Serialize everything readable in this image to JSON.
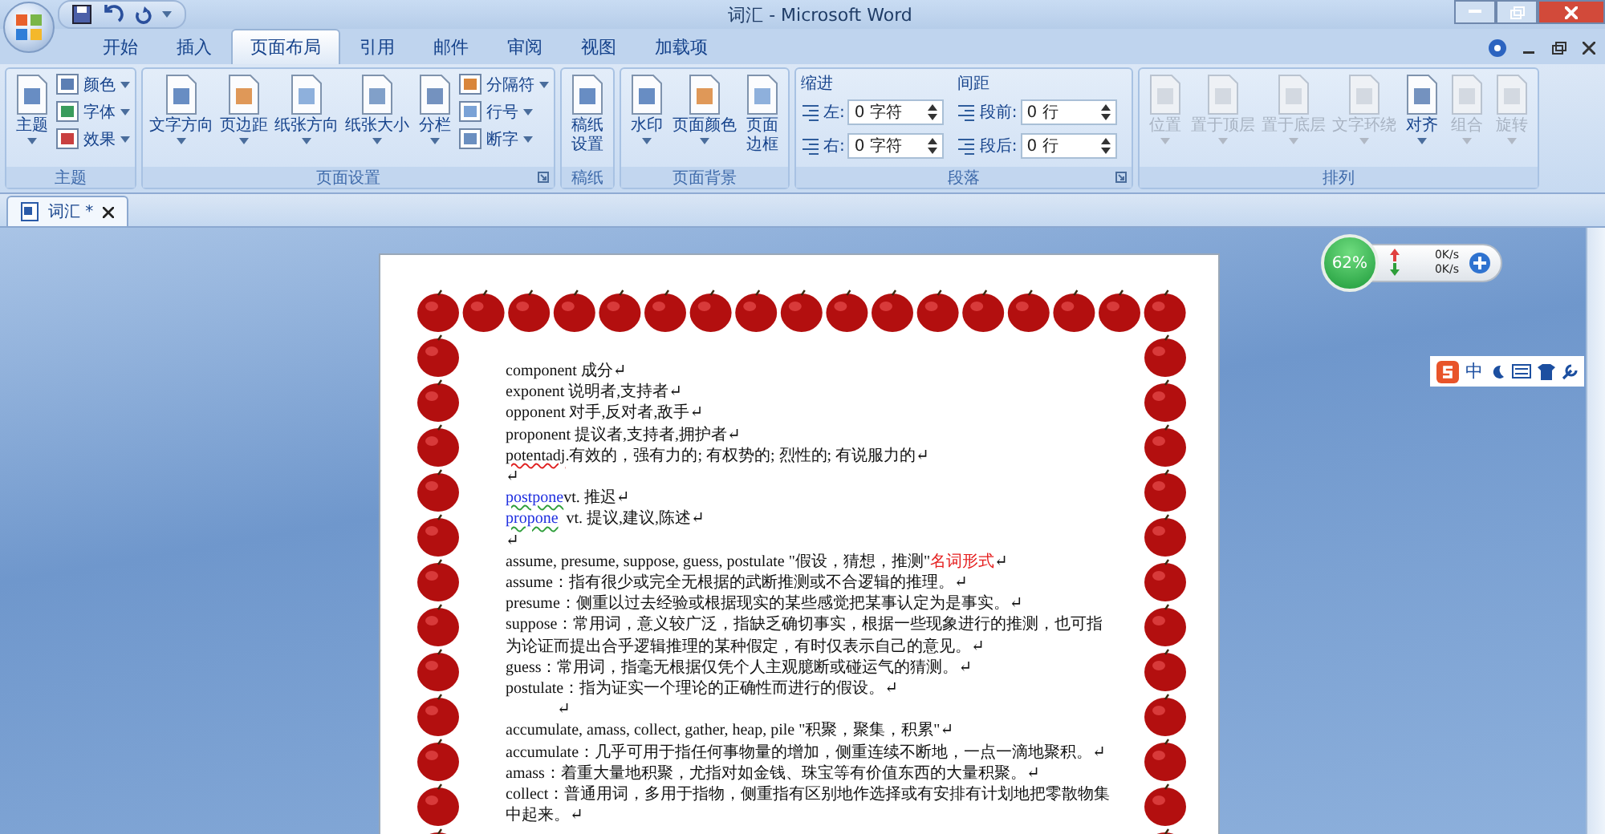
{
  "window": {
    "title": "词汇 - Microsoft Word"
  },
  "tabs": [
    {
      "label": "开始",
      "selected": false
    },
    {
      "label": "插入",
      "selected": false
    },
    {
      "label": "页面布局",
      "selected": true
    },
    {
      "label": "引用",
      "selected": false
    },
    {
      "label": "邮件",
      "selected": false
    },
    {
      "label": "审阅",
      "selected": false
    },
    {
      "label": "视图",
      "selected": false
    },
    {
      "label": "加载项",
      "selected": false
    }
  ],
  "ribbon": [
    {
      "kind": "buttons",
      "label": "主题",
      "launcher": false,
      "items": [
        {
          "kind": "large",
          "label": "主题",
          "dropdown": true,
          "disabled": false
        },
        {
          "kind": "small",
          "label": "颜色",
          "dropdown": true,
          "disabled": false
        },
        {
          "kind": "small",
          "label": "字体",
          "dropdown": true,
          "disabled": false
        },
        {
          "kind": "small",
          "label": "效果",
          "dropdown": true,
          "disabled": false
        }
      ]
    },
    {
      "kind": "buttons",
      "label": "页面设置",
      "launcher": true,
      "items": [
        {
          "kind": "large",
          "label": "文字方向",
          "dropdown": true,
          "disabled": false
        },
        {
          "kind": "large",
          "label": "页边距",
          "dropdown": true,
          "disabled": false
        },
        {
          "kind": "large",
          "label": "纸张方向",
          "dropdown": true,
          "disabled": false
        },
        {
          "kind": "large",
          "label": "纸张大小",
          "dropdown": true,
          "disabled": false
        },
        {
          "kind": "large",
          "label": "分栏",
          "dropdown": true,
          "disabled": false
        },
        {
          "kind": "small",
          "label": "分隔符",
          "dropdown": true,
          "disabled": false
        },
        {
          "kind": "small",
          "label": "行号",
          "dropdown": true,
          "disabled": false
        },
        {
          "kind": "small",
          "label": "断字",
          "dropdown": true,
          "disabled": false
        }
      ]
    },
    {
      "kind": "buttons",
      "label": "稿纸",
      "launcher": false,
      "items": [
        {
          "kind": "stacked",
          "label": "稿纸设置",
          "dropdown": false,
          "disabled": false
        }
      ]
    },
    {
      "kind": "buttons",
      "label": "页面背景",
      "launcher": false,
      "items": [
        {
          "kind": "large",
          "label": "水印",
          "dropdown": true,
          "disabled": false
        },
        {
          "kind": "large",
          "label": "页面颜色",
          "dropdown": true,
          "disabled": false
        },
        {
          "kind": "stacked",
          "label": "页面边框",
          "dropdown": false,
          "disabled": false
        }
      ]
    },
    {
      "kind": "spacing",
      "label": "段落",
      "launcher": true,
      "columns": [
        {
          "heading": "缩进",
          "fields": [
            {
              "label": "左:",
              "value": "0 字符"
            },
            {
              "label": "右:",
              "value": "0 字符"
            }
          ]
        },
        {
          "heading": "间距",
          "fields": [
            {
              "label": "段前:",
              "value": "0 行"
            },
            {
              "label": "段后:",
              "value": "0 行"
            }
          ]
        }
      ]
    },
    {
      "kind": "buttons",
      "label": "排列",
      "launcher": false,
      "items": [
        {
          "kind": "large",
          "label": "位置",
          "dropdown": true,
          "disabled": true
        },
        {
          "kind": "large",
          "label": "置于顶层",
          "dropdown": true,
          "disabled": true
        },
        {
          "kind": "large",
          "label": "置于底层",
          "dropdown": true,
          "disabled": true
        },
        {
          "kind": "large",
          "label": "文字环绕",
          "dropdown": true,
          "disabled": true
        },
        {
          "kind": "large",
          "label": "对齐",
          "dropdown": true,
          "disabled": false
        },
        {
          "kind": "large",
          "label": "组合",
          "dropdown": true,
          "disabled": true
        },
        {
          "kind": "stacked",
          "label": "旋转",
          "dropdown": true,
          "disabled": true
        }
      ]
    }
  ],
  "document_tab": {
    "label": "词汇 *"
  },
  "speed_widget": {
    "percent": "62%",
    "upload": "0K/s",
    "download": "0K/s"
  },
  "ime_bar": {
    "label": "中"
  },
  "lines": [
    {
      "kind": "text",
      "runs": [
        {
          "kind": "plain",
          "text": "component 成分↵"
        }
      ]
    },
    {
      "kind": "text",
      "runs": [
        {
          "kind": "plain",
          "text": "exponent 说明者,支持者↵"
        }
      ]
    },
    {
      "kind": "text",
      "runs": [
        {
          "kind": "plain",
          "text": "opponent 对手,反对者,敌手↵"
        }
      ]
    },
    {
      "kind": "text",
      "runs": [
        {
          "kind": "plain",
          "text": "proponent 提议者,支持者,拥护者↵"
        }
      ]
    },
    {
      "kind": "text",
      "runs": [
        {
          "kind": "misspelled",
          "text": "potentadj"
        },
        {
          "kind": "plain",
          "text": ".有效的，强有力的; 有权势的; 烈性的; 有说服力的↵"
        }
      ]
    },
    {
      "kind": "text",
      "runs": [
        {
          "kind": "plain",
          "text": "↵"
        }
      ]
    },
    {
      "kind": "text",
      "runs": [
        {
          "kind": "link",
          "text": "postpone"
        },
        {
          "kind": "plain",
          "text": "vt. 推迟↵"
        }
      ]
    },
    {
      "kind": "text",
      "runs": [
        {
          "kind": "link",
          "text": "propone"
        },
        {
          "kind": "plain",
          "text": "  vt. 提议,建议,陈述↵"
        }
      ]
    },
    {
      "kind": "text",
      "runs": [
        {
          "kind": "plain",
          "text": "↵"
        }
      ]
    },
    {
      "kind": "text",
      "runs": [
        {
          "kind": "plain",
          "text": "assume, presume, suppose, guess, postulate \"假设，猜想，推测\""
        },
        {
          "kind": "accent",
          "text": "名词形式"
        },
        {
          "kind": "plain",
          "text": "↵"
        }
      ]
    },
    {
      "kind": "text",
      "runs": [
        {
          "kind": "plain",
          "text": "assume：指有很少或完全无根据的武断推测或不合逻辑的推理。↵"
        }
      ]
    },
    {
      "kind": "text",
      "runs": [
        {
          "kind": "plain",
          "text": "presume：侧重以过去经验或根据现实的某些感觉把某事认定为是事实。↵"
        }
      ]
    },
    {
      "kind": "text",
      "runs": [
        {
          "kind": "plain",
          "text": "suppose：常用词，意义较广泛，指缺乏确切事实，根据一些现象进行的推测，也可指为论证而提出合乎逻辑推理的某种假定，有时仅表示自己的意见。↵"
        }
      ]
    },
    {
      "kind": "text",
      "runs": [
        {
          "kind": "plain",
          "text": "guess：常用词，指毫无根据仅凭个人主观臆断或碰运气的猜测。↵"
        }
      ]
    },
    {
      "kind": "text",
      "runs": [
        {
          "kind": "plain",
          "text": "postulate：指为证实一个理论的正确性而进行的假设。↵"
        }
      ]
    },
    {
      "kind": "indented",
      "runs": [
        {
          "kind": "plain",
          "text": "↵"
        }
      ]
    },
    {
      "kind": "text",
      "runs": [
        {
          "kind": "plain",
          "text": "accumulate, amass, collect, gather, heap, pile \"积聚，聚集，积累\"↵"
        }
      ]
    },
    {
      "kind": "text",
      "runs": [
        {
          "kind": "plain",
          "text": "accumulate：几乎可用于指任何事物量的增加，侧重连续不断地，一点一滴地聚积。↵"
        }
      ]
    },
    {
      "kind": "text",
      "runs": [
        {
          "kind": "plain",
          "text": "amass：着重大量地积聚，尤指对如金钱、珠宝等有价值东西的大量积聚。↵"
        }
      ]
    },
    {
      "kind": "text",
      "runs": [
        {
          "kind": "plain",
          "text": "collect：普通用词，多用于指物，侧重指有区别地作选择或有安排有计划地把零散物集中起来。↵"
        }
      ]
    }
  ]
}
